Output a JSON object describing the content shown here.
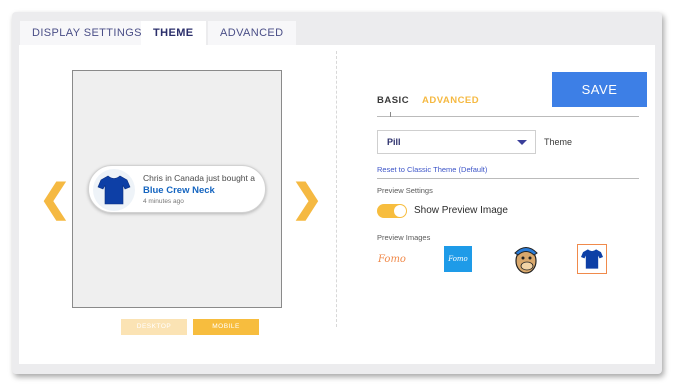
{
  "tabs": [
    {
      "label": "DISPLAY SETTINGS",
      "active": false
    },
    {
      "label": "THEME",
      "active": true
    },
    {
      "label": "ADVANCED",
      "active": false
    }
  ],
  "preview": {
    "notification": {
      "line1": "Chris in Canada just bought a",
      "product": "Blue Crew Neck",
      "time": "4 minutes ago"
    },
    "device_buttons": {
      "desktop": "DESKTOP",
      "mobile": "MOBILE"
    }
  },
  "settings": {
    "subtabs": {
      "basic": "BASIC",
      "advanced": "ADVANCED"
    },
    "save_label": "SAVE",
    "theme_select": {
      "value": "Pill",
      "label": "Theme"
    },
    "reset_link": "Reset to Classic Theme (Default)",
    "preview_settings_heading": "Preview Settings",
    "show_preview_image": {
      "label": "Show Preview Image",
      "enabled": true
    },
    "preview_images_heading": "Preview Images",
    "preview_images": [
      {
        "name": "fomo-logo-text",
        "text": "Fomo"
      },
      {
        "name": "fomo-logo-square",
        "text": "Fomo"
      },
      {
        "name": "mailchimp-logo",
        "text": ""
      },
      {
        "name": "tshirt-image",
        "text": "",
        "selected": true
      }
    ]
  },
  "colors": {
    "accent": "#f7bd3e",
    "save": "#3d7fe6",
    "link": "#3d55c8",
    "product": "#1565c0"
  }
}
